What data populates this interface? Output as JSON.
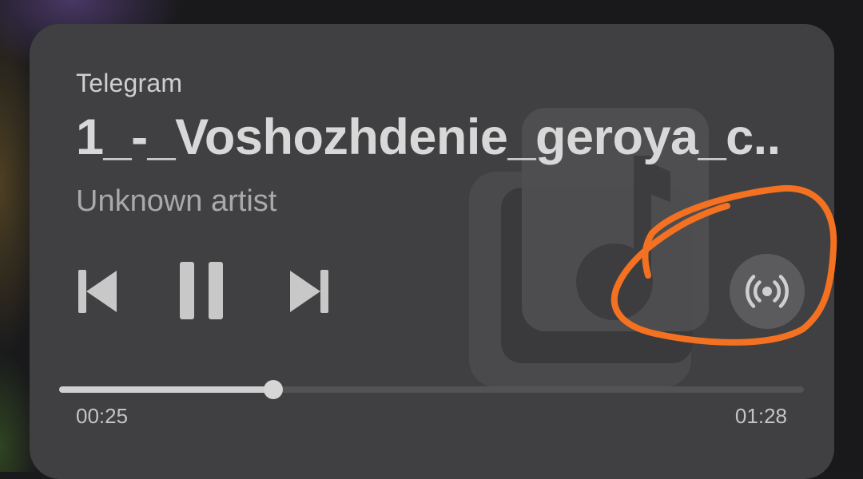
{
  "player": {
    "app_name": "Telegram",
    "title": "1_-_Voshozhdenie_geroya_c..",
    "artist": "Unknown artist",
    "elapsed": "00:25",
    "total": "01:28",
    "progress_fraction": 0.288
  },
  "controls": {
    "previous_icon": "skip-previous-icon",
    "pause_icon": "pause-icon",
    "next_icon": "skip-next-icon",
    "output_icon": "broadcast-icon"
  },
  "colors": {
    "card": "#404042",
    "text_primary": "#d8d8d8",
    "text_secondary": "#a9a9a9",
    "annotation": "#f37121"
  }
}
